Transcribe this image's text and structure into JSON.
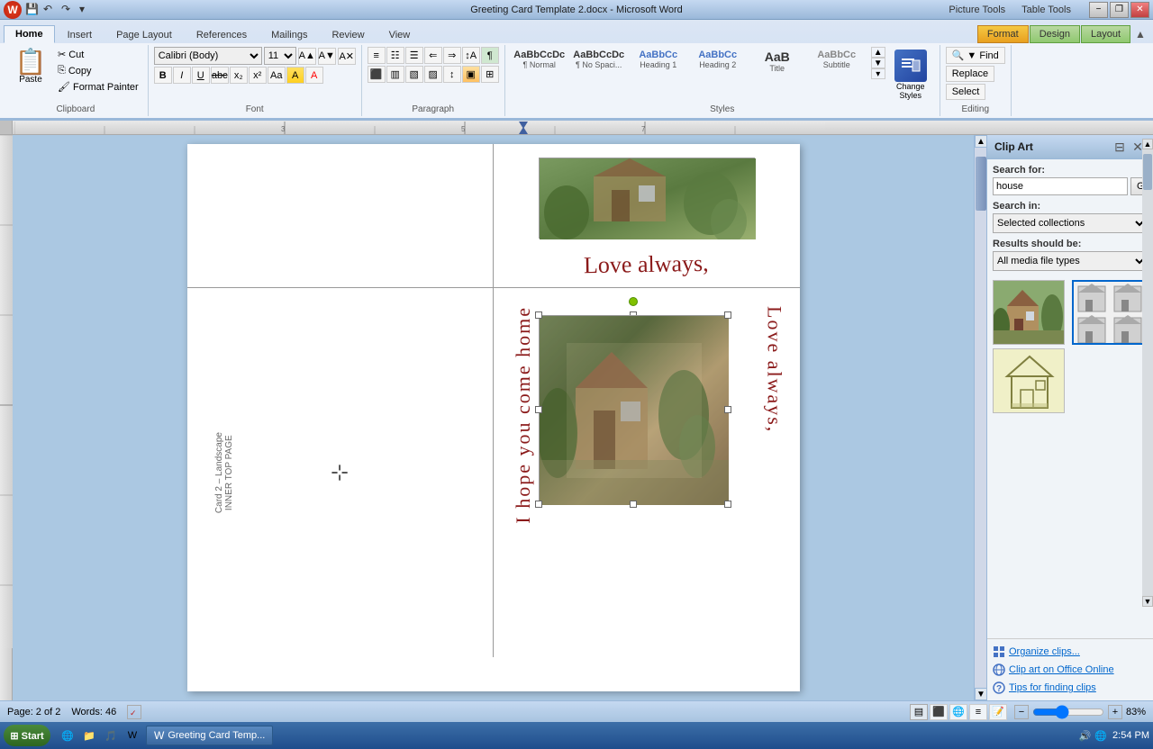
{
  "titlebar": {
    "title": "Greeting Card Template 2.docx - Microsoft Word",
    "picture_tools": "Picture Tools",
    "table_tools": "Table Tools",
    "min_btn": "−",
    "restore_btn": "❐",
    "close_btn": "✕"
  },
  "tabs": {
    "home": "Home",
    "insert": "Insert",
    "page_layout": "Page Layout",
    "references": "References",
    "mailings": "Mailings",
    "review": "Review",
    "view": "View",
    "format": "Format",
    "design": "Design",
    "layout": "Layout"
  },
  "clipboard": {
    "label": "Clipboard",
    "paste_label": "Paste",
    "cut_label": "Cut",
    "copy_label": "Copy",
    "format_painter_label": "Format Painter"
  },
  "font": {
    "label": "Font",
    "name": "Calibri (Body)",
    "size": "11",
    "bold": "B",
    "italic": "I",
    "underline": "U",
    "strikethrough": "abc",
    "subscript": "x₂",
    "superscript": "x²",
    "change_case": "Aa",
    "highlight": "A",
    "font_color": "A"
  },
  "paragraph": {
    "label": "Paragraph",
    "bullets": "☰",
    "numbering": "☷",
    "align_left": "≡",
    "align_center": "≡",
    "align_right": "≡",
    "justify": "≡",
    "line_spacing": "↕",
    "indent_dec": "◁",
    "indent_inc": "▷",
    "sort": "↕",
    "show_para": "¶"
  },
  "styles": {
    "label": "Styles",
    "normal": "AaBbCcDc",
    "normal_label": "¶ Normal",
    "no_spacing": "AaBbCcDc",
    "no_spacing_label": "¶ No Spaci...",
    "heading1": "AaBbCc",
    "heading1_label": "Heading 1",
    "heading2": "AaBbCc",
    "heading2_label": "Heading 2",
    "title": "AaB",
    "title_label": "Title",
    "subtitle": "AaBbCc",
    "subtitle_label": "Subtitle",
    "change_styles_label": "Change\nStyles"
  },
  "editing": {
    "label": "Editing",
    "find_label": "▼ Find",
    "replace_label": "Replace",
    "select_label": "Select"
  },
  "clip_art": {
    "title": "Clip Art",
    "search_label": "Search for:",
    "search_value": "house",
    "go_btn": "Go",
    "search_in_label": "Search in:",
    "search_in_value": "Selected collections",
    "results_label": "Results should be:",
    "results_value": "All media file types",
    "organize_label": "Organize clips...",
    "office_online_label": "Clip art on Office Online",
    "tips_label": "Tips for finding clips"
  },
  "status_bar": {
    "page_info": "Page: 2 of 2",
    "words": "Words: 46",
    "normal_view": "▤",
    "zoom_level": "83%",
    "zoom_value": 83
  },
  "taskbar": {
    "start_label": "Start",
    "doc_title": "Greeting Card Temp...",
    "time": "2:54 PM",
    "icons": [
      "🔊",
      "🌐",
      "🔋"
    ]
  },
  "document": {
    "love_always": "Love always,",
    "vertical_text1": "I hope you come home",
    "vertical_text2": "Love always,",
    "card_label_line1": "Card 2 – Landscape",
    "card_label_line2": "INNER TOP PAGE"
  }
}
